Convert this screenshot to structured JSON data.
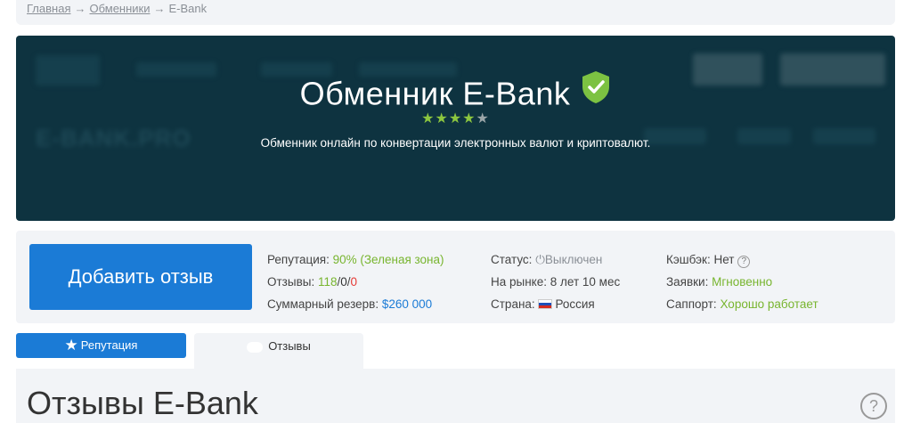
{
  "breadcrumb": {
    "items": [
      "Главная",
      "Обменники",
      "E-Bank"
    ],
    "separator": "→"
  },
  "hero": {
    "title": "Обменник E-Bank",
    "rating_stars": 4.5,
    "subtitle": "Обменник онлайн по конвертации электронных валют и криптовалют.",
    "background_logo_text": "E-BANK.PRO",
    "verified_icon": "shield-check-icon"
  },
  "info": {
    "add_review_label": "Добавить отзыв",
    "reputation": {
      "label": "Репутация:",
      "value": "90% (Зеленая зона)"
    },
    "reviews": {
      "label": "Отзывы:",
      "positive": "118",
      "neutral": "0",
      "negative": "0",
      "sep": "/"
    },
    "reserve": {
      "label": "Суммарный резерв:",
      "value": "$260 000"
    },
    "status": {
      "label": "Статус:",
      "value": "Выключен"
    },
    "market": {
      "label": "На рынке:",
      "value": "8 лет 10 мес"
    },
    "country": {
      "label": "Страна:",
      "value": "Россия"
    },
    "cashback": {
      "label": "Кэшбэк:",
      "value": "Нет"
    },
    "requests": {
      "label": "Заявки:",
      "value": "Мгновенно"
    },
    "support": {
      "label": "Саппорт:",
      "value": "Хорошо работает"
    }
  },
  "tabs": {
    "reputation_label": "Репутация",
    "reviews_label": "Отзывы"
  },
  "section": {
    "title": "Отзывы E-Bank",
    "help_glyph": "?"
  },
  "colors": {
    "accent_blue": "#1b7bd6",
    "green": "#78b52f",
    "hero_bg": "#0e3340",
    "panel_bg": "#f2f4f7"
  }
}
